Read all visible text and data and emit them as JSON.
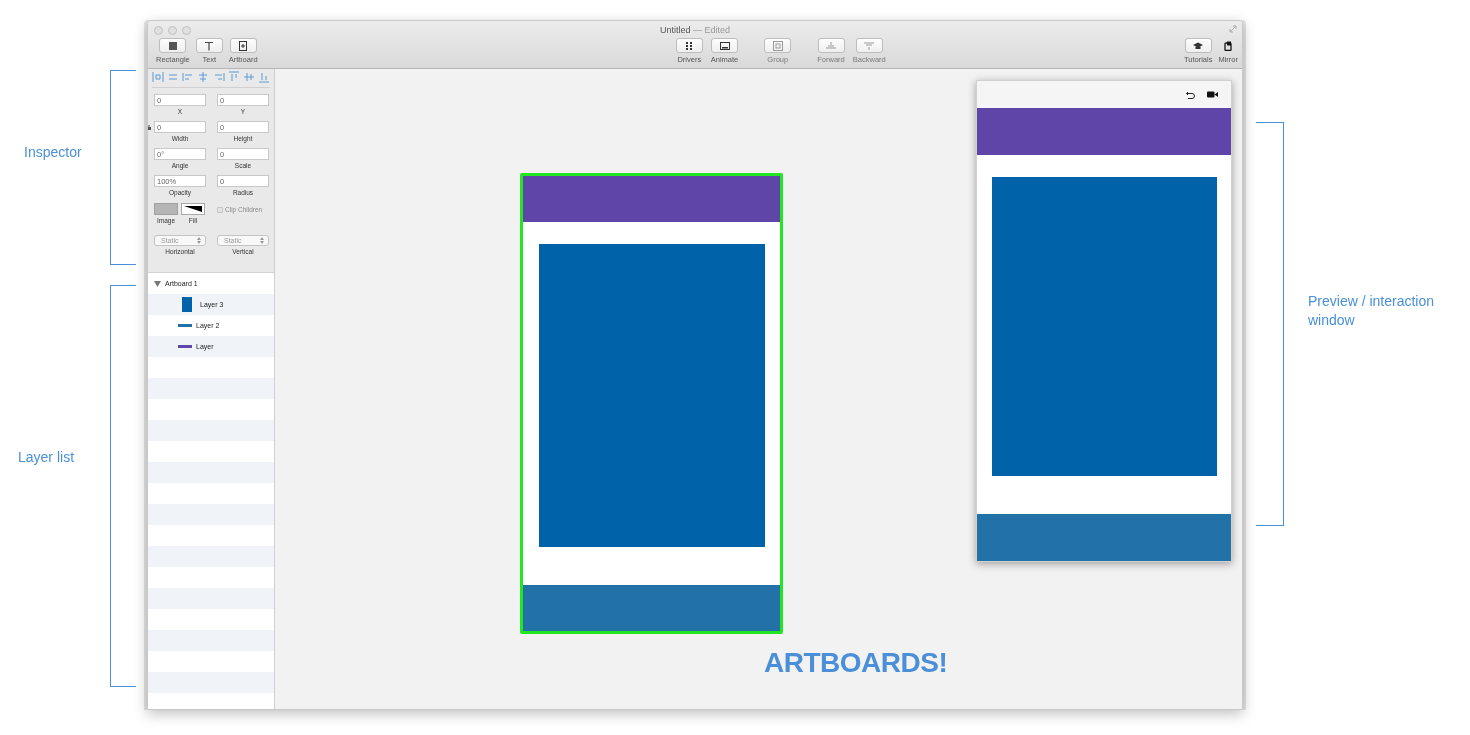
{
  "window": {
    "title": "Untitled",
    "status": "— Edited"
  },
  "toolbar": {
    "left": [
      {
        "label": "Rectangle",
        "kind": "rectangle",
        "disabled": false
      },
      {
        "label": "Text",
        "kind": "text",
        "disabled": false
      },
      {
        "label": "Artboard",
        "kind": "artboard",
        "disabled": false
      }
    ],
    "center": [
      {
        "label": "Drivers",
        "kind": "drivers",
        "disabled": false
      },
      {
        "label": "Animate",
        "kind": "animate",
        "disabled": false
      },
      {
        "label": "Group",
        "kind": "group",
        "disabled": true
      },
      {
        "label": "Forward",
        "kind": "forward",
        "disabled": true
      },
      {
        "label": "Backward",
        "kind": "backward",
        "disabled": true
      }
    ],
    "right": [
      {
        "label": "Tutorials",
        "kind": "tutorials",
        "disabled": false
      },
      {
        "label": "Mirror",
        "kind": "mirror",
        "disabled": false
      }
    ]
  },
  "inspector": {
    "fields": [
      {
        "label": "X",
        "value": "0"
      },
      {
        "label": "Y",
        "value": "0"
      },
      {
        "label": "Width",
        "value": "0"
      },
      {
        "label": "Height",
        "value": "0"
      },
      {
        "label": "Angle",
        "value": "0°"
      },
      {
        "label": "Scale",
        "value": "0"
      },
      {
        "label": "Opacity",
        "value": "100%"
      },
      {
        "label": "Radius",
        "value": "0"
      }
    ],
    "image_label": "Image",
    "fill_label": "Fill",
    "clip_children": {
      "label": "Clip Children",
      "checked": false,
      "disabled": true
    },
    "selects": [
      {
        "label": "Horizontal",
        "value": "Static"
      },
      {
        "label": "Vertical",
        "value": "Static"
      }
    ]
  },
  "layers": [
    {
      "name": "Artboard 1",
      "expanded": true,
      "children": [
        {
          "name": "Layer 3",
          "kind": "rect",
          "color": "#0062a8"
        },
        {
          "name": "Layer 2",
          "kind": "line",
          "color": "#2272a8"
        },
        {
          "name": "Layer",
          "kind": "line",
          "color": "#6046a8"
        }
      ]
    }
  ],
  "artboard": {
    "selected": true,
    "blocks": [
      {
        "kind": "header",
        "color": "#5f45a8"
      },
      {
        "kind": "content",
        "color": "#0062a8"
      },
      {
        "kind": "footer",
        "color": "#2272a8"
      }
    ]
  },
  "preview": {
    "blocks": [
      {
        "kind": "header",
        "color": "#5f45a8"
      },
      {
        "kind": "content",
        "color": "#0062a8"
      },
      {
        "kind": "footer",
        "color": "#2272a8"
      }
    ]
  },
  "annotations": [
    {
      "label": "Inspector"
    },
    {
      "label": "Layer list"
    },
    {
      "label": "Preview / interaction window"
    }
  ],
  "caption": "ARTBOARDS!"
}
